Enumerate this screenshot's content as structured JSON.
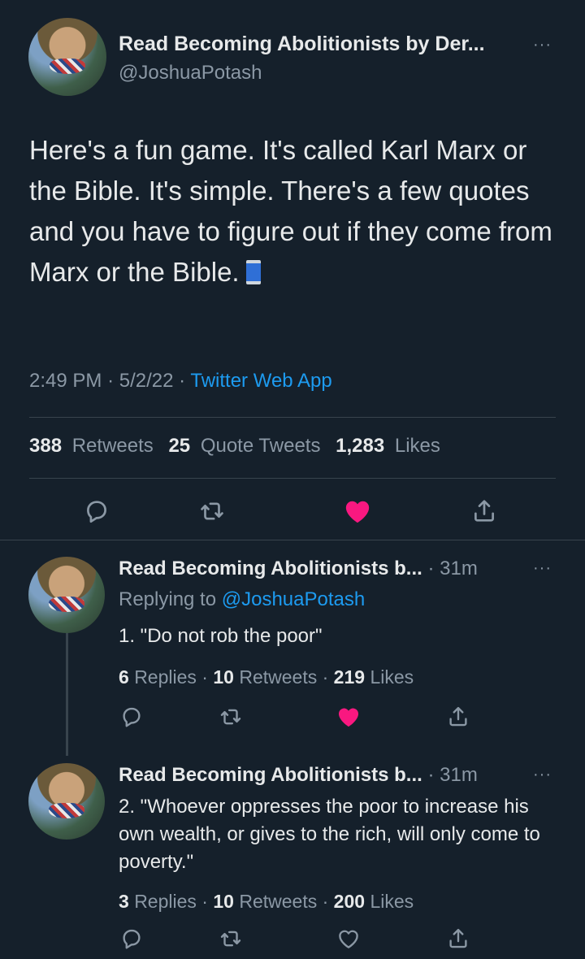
{
  "tweet": {
    "author_name": "Read Becoming Abolitionists by Der...",
    "handle": "@JoshuaPotash",
    "more": "···",
    "text": "Here's a fun game. It's called Karl Marx or the Bible. It's simple. There's a few quotes and you have to figure out if they come from Marx or the Bible.",
    "time": "2:49 PM",
    "date": "5/2/22",
    "source": "Twitter Web App",
    "sep": "·",
    "retweets_count": "388",
    "retweets_label": "Retweets",
    "quotes_count": "25",
    "quotes_label": "Quote Tweets",
    "likes_count": "1,283",
    "likes_label": "Likes",
    "liked": true
  },
  "replies": [
    {
      "author_name": "Read Becoming Abolitionists b...",
      "time": "31m",
      "replying_prefix": "Replying to",
      "replying_to": "@JoshuaPotash",
      "text": "1. \"Do not rob the poor\"",
      "replies_count": "6",
      "replies_label": "Replies",
      "retweets_count": "10",
      "retweets_label": "Retweets",
      "likes_count": "219",
      "likes_label": "Likes",
      "liked": true
    },
    {
      "author_name": "Read Becoming Abolitionists b...",
      "time": "31m",
      "text": "2. \"Whoever oppresses the poor to increase his own wealth, or gives to the rich, will only come to poverty.\"",
      "replies_count": "3",
      "replies_label": "Replies",
      "retweets_count": "10",
      "retweets_label": "Retweets",
      "likes_count": "200",
      "likes_label": "Likes",
      "liked": false
    }
  ],
  "colors": {
    "background": "#15202b",
    "accent": "#1d9bf0",
    "like": "#f91880",
    "muted": "#8b98a5"
  },
  "icons": [
    "reply-icon",
    "retweet-icon",
    "like-icon",
    "share-icon",
    "more-icon",
    "spool-of-thread-emoji"
  ]
}
